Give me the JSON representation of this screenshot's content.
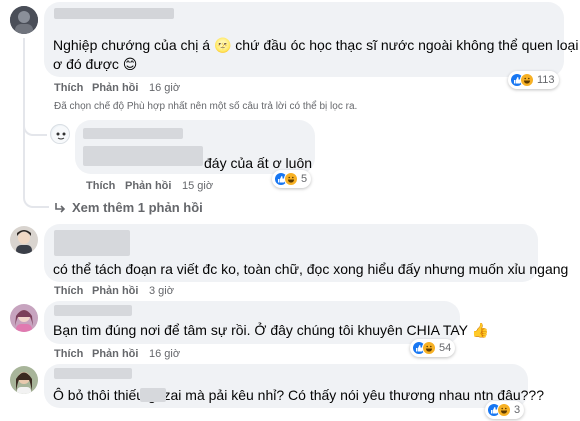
{
  "comments": [
    {
      "text_lines": [
        "Nghiệp chướng của chị á 🌝 chứ đầu óc học thạc sĩ nước ngoài không thể quen loại ất",
        "ơ đó được 😊"
      ],
      "actions": {
        "like": "Thích",
        "reply": "Phản hồi"
      },
      "time": "16 giờ",
      "reaction_count": "113",
      "filter_note": "Đã chọn chế độ Phù hợp nhất nên một số câu trả lời có thể bị lọc ra."
    },
    {
      "text": "đáy của ất ơ luôn",
      "actions": {
        "like": "Thích",
        "reply": "Phản hồi"
      },
      "time": "15 giờ",
      "reaction_count": "5"
    },
    {
      "text": "có thể tách đoạn ra viết đc ko, toàn chữ, đọc xong hiểu đấy nhưng muốn xỉu ngang",
      "actions": {
        "like": "Thích",
        "reply": "Phản hồi"
      },
      "time": "3 giờ"
    },
    {
      "text": "Bạn tìm đúng nơi để tâm sự rồi. Ở đây chúng tôi khuyên CHIA TAY 👍",
      "actions": {
        "like": "Thích",
        "reply": "Phản hồi"
      },
      "time": "16 giờ",
      "reaction_count": "54"
    },
    {
      "text": "Ô bỏ thôi thiếu      gì zai mà pải kêu nhỉ? Có thấy nói yêu thương nhau ntn đâu???",
      "actions": {
        "like": "Thích",
        "reply": "Phản hồi"
      },
      "time": "15 giờ",
      "reaction_count": "3"
    }
  ],
  "view_more_replies": "Xem thêm 1 phản hồi",
  "colors": {
    "bubble": "#f0f2f5",
    "secondary_text": "#65676b",
    "like_blue": "#1877f2",
    "haha_yellow": "#f7b125"
  },
  "icons": [
    "like-icon",
    "haha-icon",
    "reply-arrow-icon"
  ]
}
